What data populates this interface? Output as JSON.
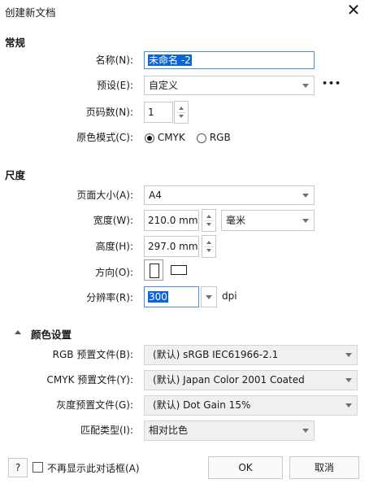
{
  "window": {
    "title": "创建新文档",
    "close_glyph": "✕"
  },
  "general": {
    "heading": "常规",
    "name_label": "名称(N):",
    "name_value": "未命名 -2",
    "preset_label": "预设(E):",
    "preset_value": "自定义",
    "more_glyph": "•••",
    "pages_label": "页码数(N):",
    "pages_value": "1",
    "color_mode_label": "原色模式(C):",
    "color_mode_options": [
      "CMYK",
      "RGB"
    ],
    "color_mode_selected": "CMYK"
  },
  "dimensions": {
    "heading": "尺度",
    "page_size_label": "页面大小(A):",
    "page_size_value": "A4",
    "width_label": "宽度(W):",
    "width_value": "210.0 mm",
    "unit_value": "毫米",
    "height_label": "高度(H):",
    "height_value": "297.0 mm",
    "orientation_label": "方向(O):",
    "resolution_label": "分辨率(R):",
    "resolution_value": "300",
    "resolution_unit": "dpi"
  },
  "color_settings": {
    "heading": "颜色设置",
    "rgb_label": "RGB 预置文件(B):",
    "rgb_value": "(默认)  sRGB IEC61966-2.1",
    "cmyk_label": "CMYK 预置文件(Y):",
    "cmyk_value": "(默认)  Japan Color 2001 Coated",
    "gray_label": "灰度预置文件(G):",
    "gray_value": "(默认)  Dot Gain 15%",
    "match_label": "匹配类型(I):",
    "match_value": "相对比色"
  },
  "footer": {
    "help_label": "?",
    "dont_show_label": "不再显示此对话框(A)",
    "ok_label": "OK",
    "cancel_label": "取消"
  }
}
